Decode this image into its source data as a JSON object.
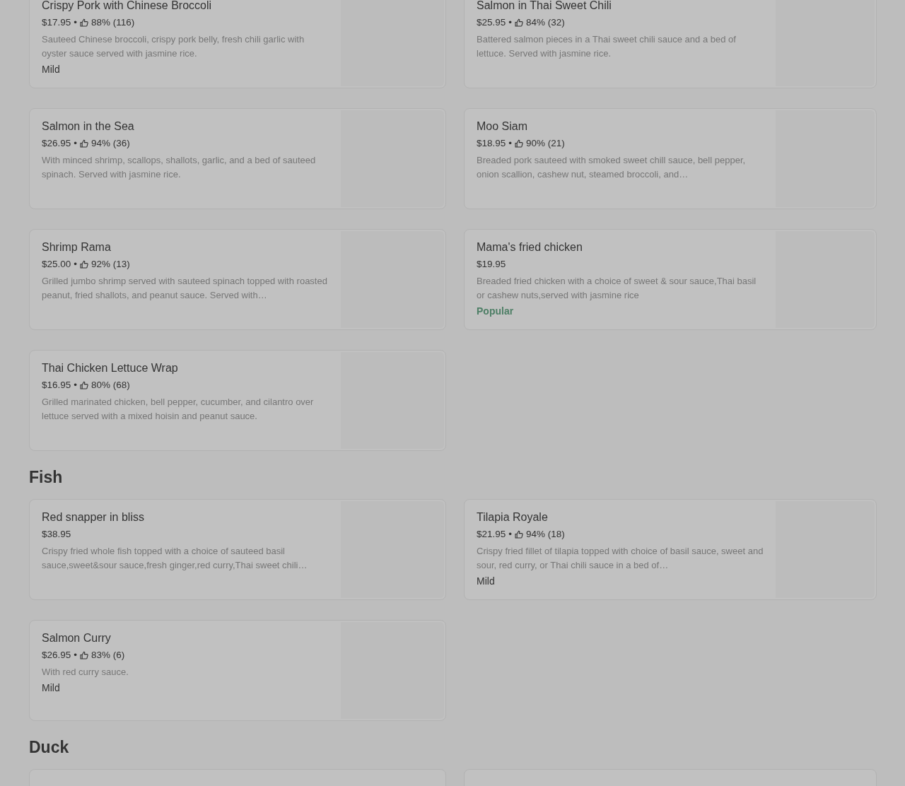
{
  "sections": [
    {
      "items": [
        {
          "name": "Crispy Pork with Chinese Broccoli",
          "price": "$17.95",
          "separator": "•",
          "rating": "88% (116)",
          "description": "Sauteed Chinese broccoli, crispy pork belly, fresh chili garlic with oyster sauce served with jasmine rice.",
          "tag": {
            "text": "Mild",
            "kind": "spice"
          }
        },
        {
          "name": "Salmon in Thai Sweet Chili",
          "price": "$25.95",
          "separator": "•",
          "rating": "84% (32)",
          "description": "Battered salmon pieces in a Thai sweet chili sauce and a bed of lettuce. Served with jasmine rice."
        },
        {
          "name": "Salmon in the Sea",
          "price": "$26.95",
          "separator": "•",
          "rating": "94% (36)",
          "description": "With minced shrimp, scallops, shallots, garlic, and a bed of sauteed spinach. Served with jasmine rice."
        },
        {
          "name": "Moo Siam",
          "price": "$18.95",
          "separator": "•",
          "rating": "90% (21)",
          "description": "Breaded pork sauteed with smoked sweet chill sauce, bell pepper, onion scallion, cashew nut, steamed broccoli, and…"
        },
        {
          "name": "Shrimp Rama",
          "price": "$25.00",
          "separator": "•",
          "rating": "92% (13)",
          "description": "Grilled jumbo shrimp served with sauteed spinach topped with roasted peanut, fried shallots, and peanut sauce. Served with…"
        },
        {
          "name": "Mama's fried chicken",
          "price": "$19.95",
          "description": "Breaded fried chicken with a choice of sweet & sour sauce,Thai basil or cashew nuts,served with jasmine rice",
          "tag": {
            "text": "Popular",
            "kind": "popular"
          }
        },
        {
          "name": "Thai Chicken Lettuce Wrap",
          "price": "$16.95",
          "separator": "•",
          "rating": "80% (68)",
          "description": "Grilled marinated chicken, bell pepper, cucumber, and cilantro over lettuce served with a mixed hoisin and peanut sauce."
        }
      ]
    },
    {
      "title": "Fish",
      "items": [
        {
          "name": "Red snapper in bliss",
          "price": "$38.95",
          "description": "Crispy fried whole fish topped with a choice of sauteed basil sauce,sweet&sour sauce,fresh ginger,red curry,Thai sweet chili…"
        },
        {
          "name": "Tilapia Royale",
          "price": "$21.95",
          "separator": "•",
          "rating": "94% (18)",
          "description": "Crispy fried fillet of tilapia topped with choice of basil sauce, sweet and sour, red curry, or Thai chili sauce in a bed of…",
          "tag": {
            "text": "Mild",
            "kind": "spice"
          }
        },
        {
          "name": "Salmon Curry",
          "price": "$26.95",
          "separator": "•",
          "rating": "83% (6)",
          "description": "With red curry sauce.",
          "tag": {
            "text": "Mild",
            "kind": "spice"
          }
        }
      ]
    },
    {
      "title": "Duck",
      "cards_cut_off": true
    }
  ]
}
